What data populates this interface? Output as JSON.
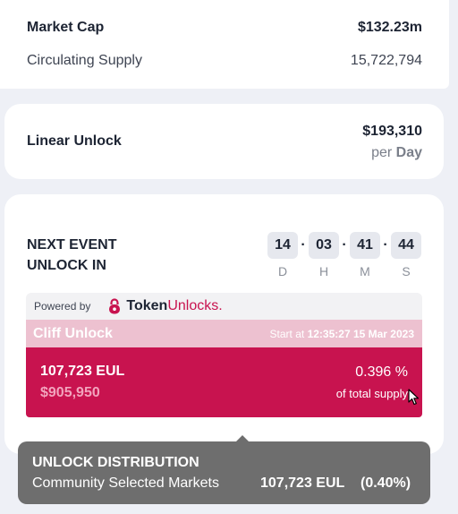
{
  "market": {
    "market_cap_label": "Market Cap",
    "market_cap_value": "$132.23m",
    "circulating_label": "Circulating Supply",
    "circulating_value": "15,722,794"
  },
  "linear": {
    "label": "Linear Unlock",
    "amount": "$193,310",
    "per_prefix": "per",
    "per_unit": "Day"
  },
  "next_event": {
    "label_line1": "NEXT EVENT",
    "label_line2": "UNLOCK IN",
    "countdown": [
      {
        "value": "14",
        "unit": "D"
      },
      {
        "value": "03",
        "unit": "H"
      },
      {
        "value": "41",
        "unit": "M"
      },
      {
        "value": "44",
        "unit": "S"
      }
    ],
    "separator": "·"
  },
  "powered": {
    "label": "Powered by",
    "brand_token": "Token",
    "brand_unlocks": "Unlocks.",
    "brand_color": "#c8134f",
    "icon": "lock-icon"
  },
  "cliff": {
    "title": "Cliff Unlock",
    "start_prefix": "Start at",
    "start_value": "12:35:27 15 Mar 2023",
    "amount": "107,723 EUL",
    "usd": "$905,950",
    "percent": "0.396 %",
    "percent_label": "of total supply",
    "header_color": "#edc1d0",
    "body_color": "#c8134f"
  },
  "tooltip": {
    "title": "UNLOCK DISTRIBUTION",
    "name": "Community Selected Markets",
    "value": "107,723 EUL",
    "percent": "(0.40%)"
  }
}
